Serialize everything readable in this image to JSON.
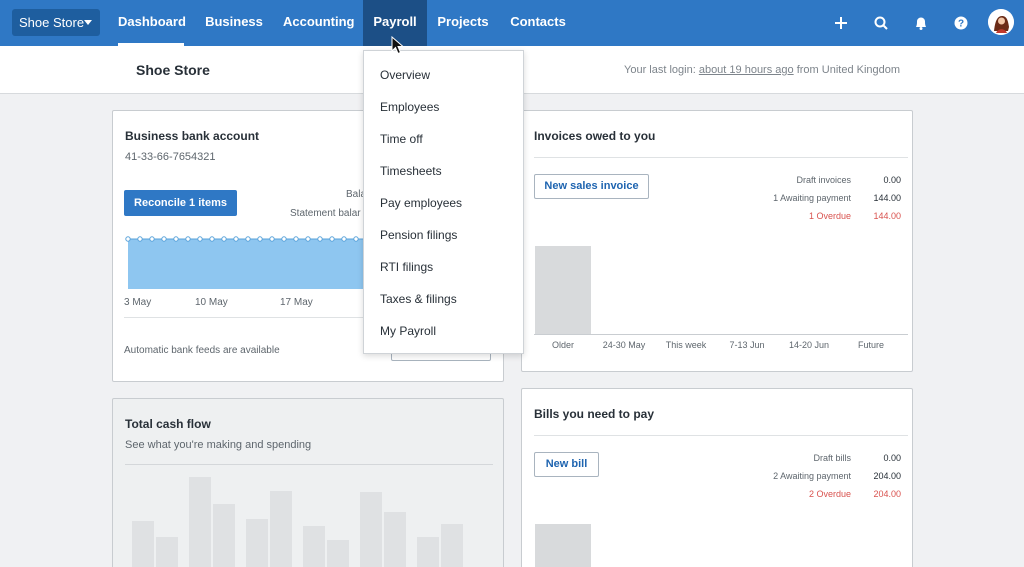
{
  "org_switcher": {
    "label": "Shoe Store"
  },
  "nav": {
    "items": [
      {
        "label": "Dashboard"
      },
      {
        "label": "Business"
      },
      {
        "label": "Accounting"
      },
      {
        "label": "Payroll"
      },
      {
        "label": "Projects"
      },
      {
        "label": "Contacts"
      }
    ],
    "icons": [
      "plus-icon",
      "search-icon",
      "bell-icon",
      "help-icon",
      "avatar"
    ]
  },
  "subheader": {
    "org_name": "Shoe Store",
    "last_login_prefix": "Your last login:",
    "last_login_time": "about 19 hours ago",
    "last_login_suffix": "from United Kingdom"
  },
  "payroll_menu": {
    "items": [
      "Overview",
      "Employees",
      "Time off",
      "Timesheets",
      "Pay employees",
      "Pension filings",
      "RTI filings",
      "Taxes & filings",
      "My Payroll"
    ]
  },
  "bank_card": {
    "title": "Business bank account",
    "account_number": "41-33-66-7654321",
    "reconcile_button": "Reconcile 1 items",
    "balance_label_partial": "Bala",
    "statement_label_partial": "Statement balar",
    "x_labels": [
      "3 May",
      "10 May",
      "17 May"
    ],
    "footer_text": "Automatic bank feeds are available"
  },
  "invoices_card": {
    "title": "Invoices owed to you",
    "new_button": "New sales invoice",
    "rows": [
      {
        "label": "Draft invoices",
        "value": "0.00",
        "alert": false
      },
      {
        "label": "1 Awaiting payment",
        "value": "144.00",
        "alert": false
      },
      {
        "label": "1 Overdue",
        "value": "144.00",
        "alert": true
      }
    ],
    "x_labels": [
      "Older",
      "24-30 May",
      "This week",
      "7-13 Jun",
      "14-20 Jun",
      "Future"
    ]
  },
  "cashflow_card": {
    "title": "Total cash flow",
    "subtitle": "See what you're making and spending"
  },
  "bills_card": {
    "title": "Bills you need to pay",
    "new_button": "New bill",
    "rows": [
      {
        "label": "Draft bills",
        "value": "0.00",
        "alert": false
      },
      {
        "label": "2 Awaiting payment",
        "value": "204.00",
        "alert": false
      },
      {
        "label": "2 Overdue",
        "value": "204.00",
        "alert": true
      }
    ]
  },
  "colors": {
    "nav_bg": "#2f78c5",
    "nav_open": "#1c4f86",
    "accent": "#2f78c5",
    "overdue": "#d9534f",
    "chart_fill": "#8ec6f0"
  }
}
